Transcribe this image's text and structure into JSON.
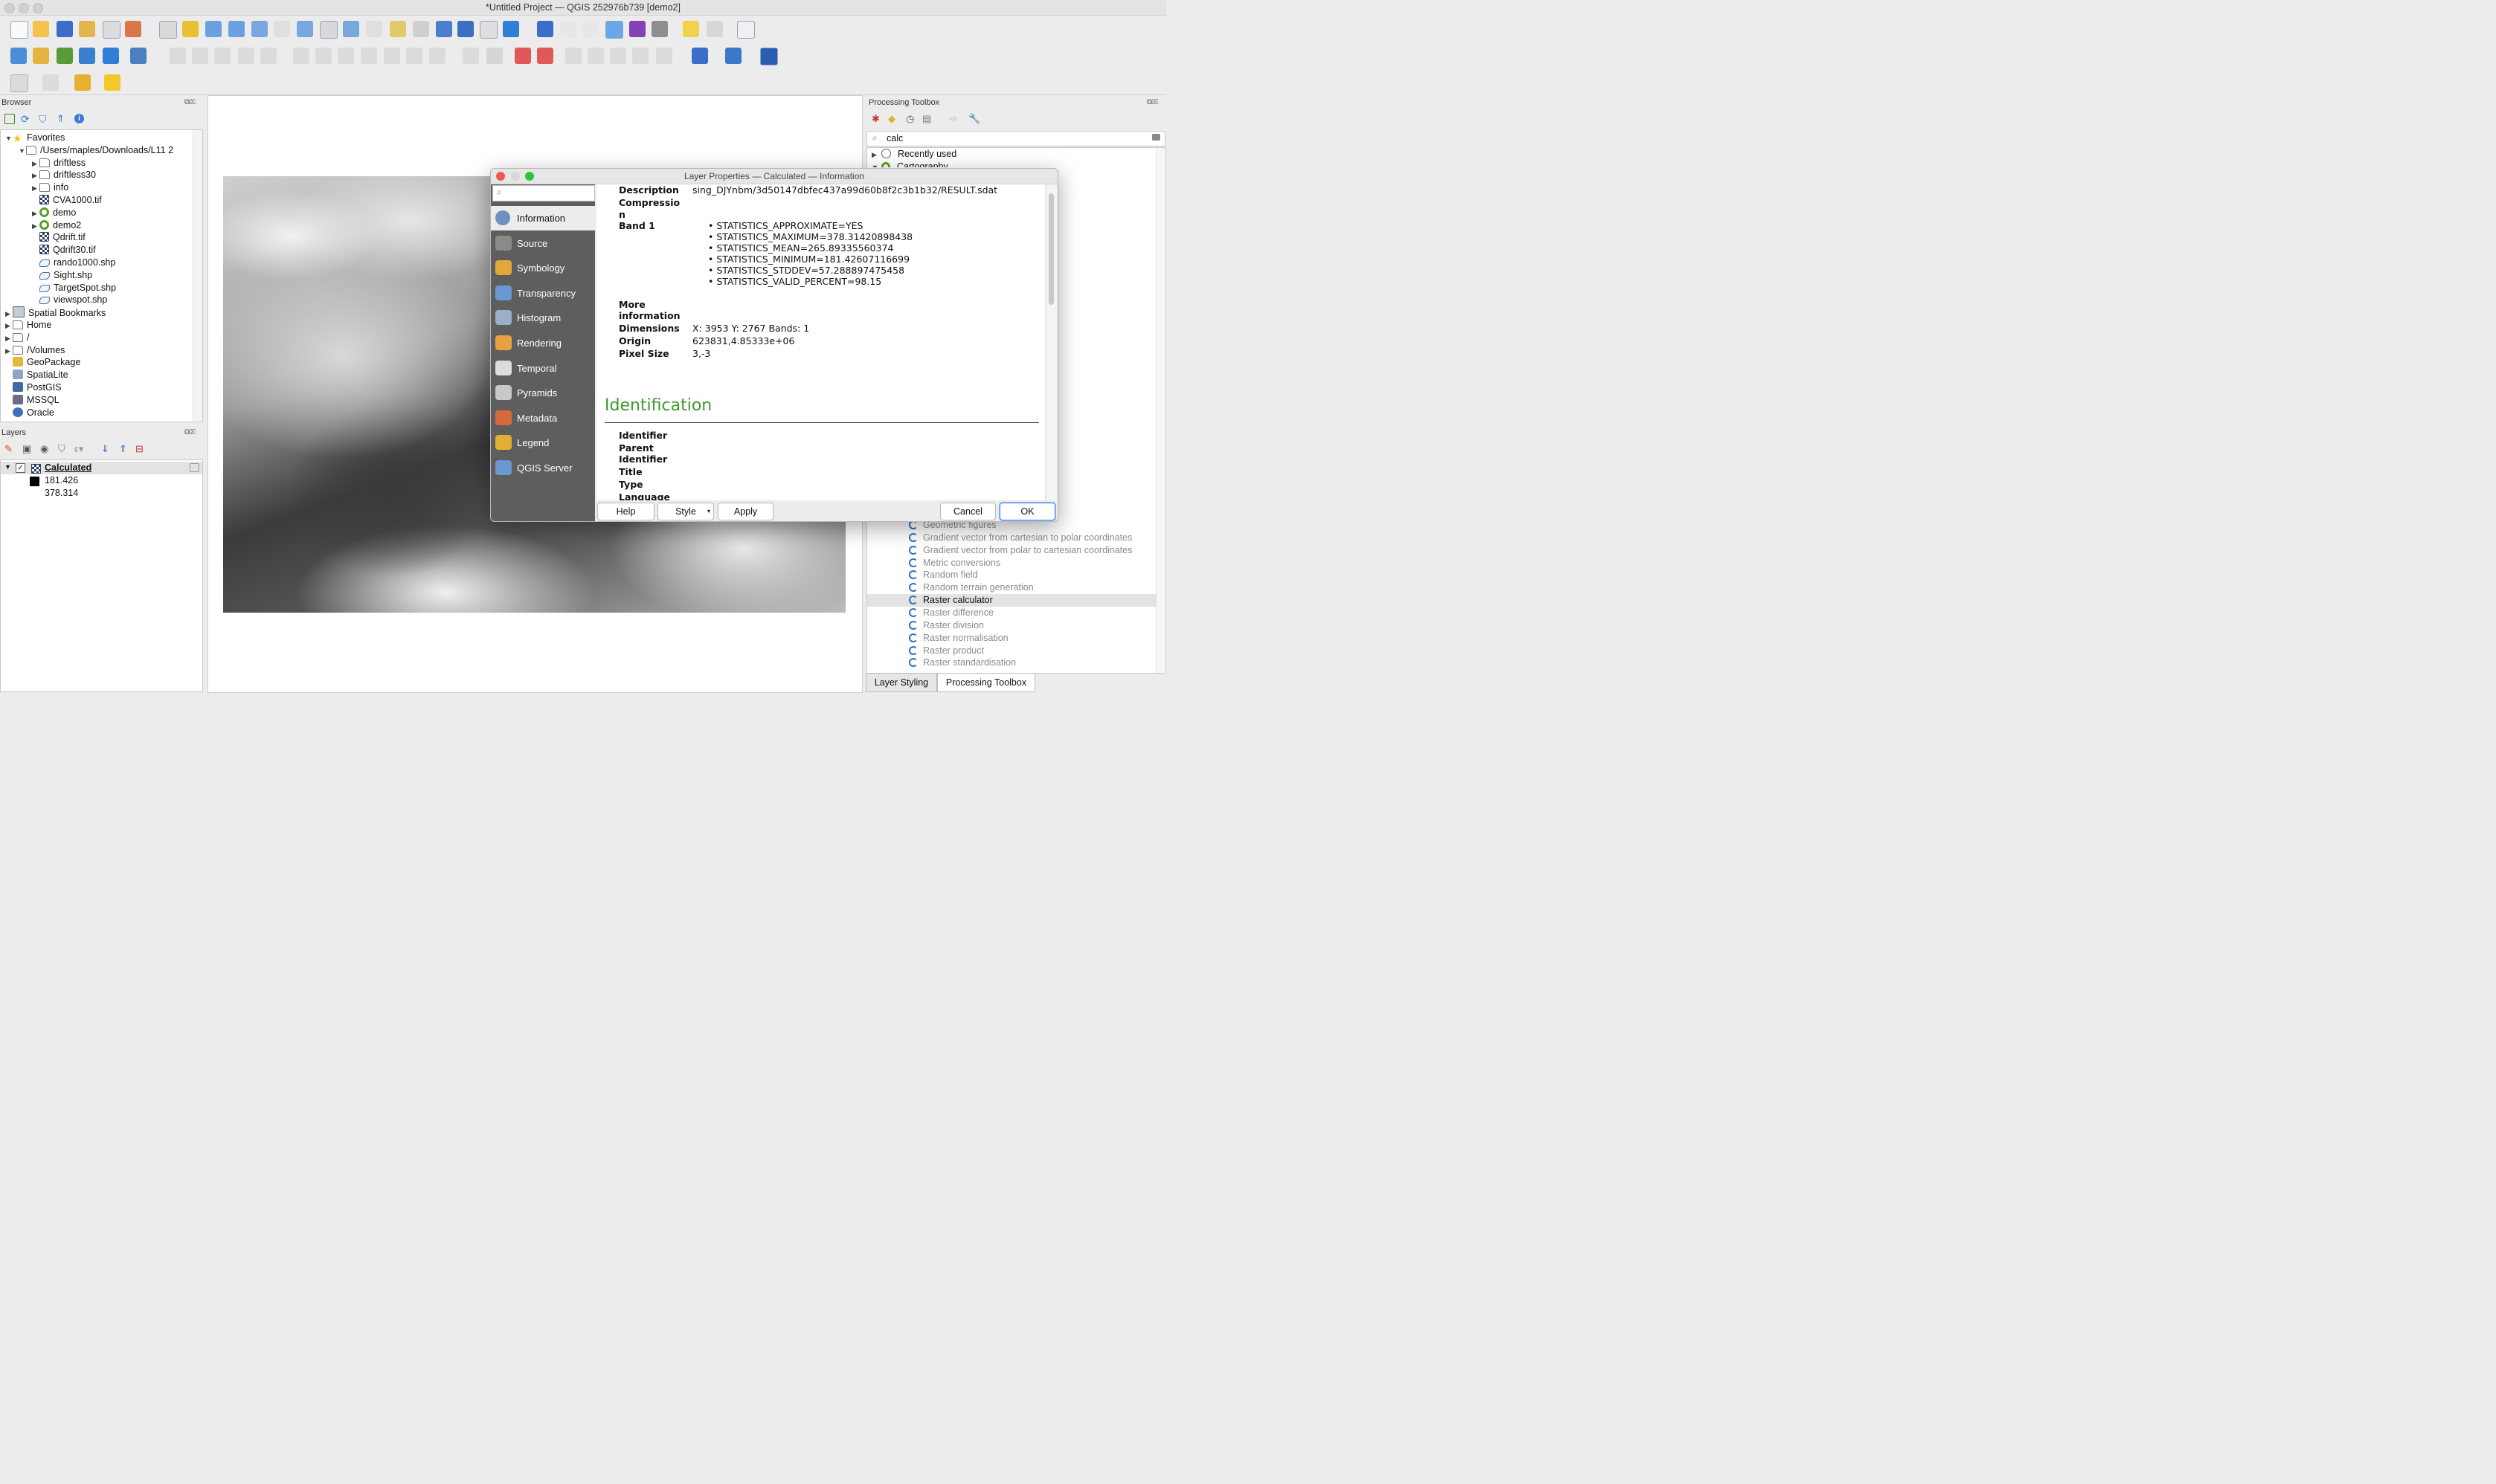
{
  "window": {
    "title": "*Untitled Project — QGIS 252976b739 [demo2]"
  },
  "browser": {
    "title": "Browser",
    "items": [
      {
        "label": "Favorites",
        "arrow": "▼",
        "icon": "star-icon"
      },
      {
        "label": "/Users/maples/Downloads/L11 2",
        "arrow": "▼",
        "icon": "folder-icon"
      },
      {
        "label": "driftless",
        "arrow": "▶",
        "icon": "folder-icon"
      },
      {
        "label": "driftless30",
        "arrow": "▶",
        "icon": "folder-icon"
      },
      {
        "label": "info",
        "arrow": "▶",
        "icon": "folder-icon"
      },
      {
        "label": "CVA1000.tif",
        "arrow": "",
        "icon": "raster-icon"
      },
      {
        "label": "demo",
        "arrow": "▶",
        "icon": "qgis-project-icon"
      },
      {
        "label": "demo2",
        "arrow": "▶",
        "icon": "qgis-project-icon"
      },
      {
        "label": "Qdrift.tif",
        "arrow": "",
        "icon": "raster-icon"
      },
      {
        "label": "Qdrift30.tif",
        "arrow": "",
        "icon": "raster-icon"
      },
      {
        "label": "rando1000.shp",
        "arrow": "",
        "icon": "vector-icon"
      },
      {
        "label": "Sight.shp",
        "arrow": "",
        "icon": "vector-icon"
      },
      {
        "label": "TargetSpot.shp",
        "arrow": "",
        "icon": "vector-icon"
      },
      {
        "label": "viewspot.shp",
        "arrow": "",
        "icon": "vector-icon"
      },
      {
        "label": "Spatial Bookmarks",
        "arrow": "▶",
        "icon": "bookmark-icon"
      },
      {
        "label": "Home",
        "arrow": "▶",
        "icon": "folder-icon"
      },
      {
        "label": "/",
        "arrow": "▶",
        "icon": "folder-icon"
      },
      {
        "label": "/Volumes",
        "arrow": "▶",
        "icon": "folder-icon"
      },
      {
        "label": "GeoPackage",
        "arrow": "",
        "icon": "geopackage-icon"
      },
      {
        "label": "SpatiaLite",
        "arrow": "",
        "icon": "spatialite-icon"
      },
      {
        "label": "PostGIS",
        "arrow": "",
        "icon": "postgis-icon"
      },
      {
        "label": "MSSQL",
        "arrow": "",
        "icon": "mssql-icon"
      },
      {
        "label": "Oracle",
        "arrow": "",
        "icon": "oracle-icon"
      }
    ]
  },
  "layers": {
    "title": "Layers",
    "layer_name": "Calculated",
    "min": "181.426",
    "max": "378.314"
  },
  "toolbox": {
    "title": "Processing Toolbox",
    "search_value": "calc",
    "groups": [
      {
        "label": "Recently used"
      },
      {
        "label": "Cartography"
      }
    ],
    "algorithms": [
      {
        "label": "Geometric figures",
        "selected": false
      },
      {
        "label": "Gradient vector from cartesian to polar coordinates",
        "selected": false
      },
      {
        "label": "Gradient vector from polar to cartesian coordinates",
        "selected": false
      },
      {
        "label": "Metric conversions",
        "selected": false
      },
      {
        "label": "Random field",
        "selected": false
      },
      {
        "label": "Random terrain generation",
        "selected": false
      },
      {
        "label": "Raster calculator",
        "selected": true
      },
      {
        "label": "Raster difference",
        "selected": false
      },
      {
        "label": "Raster division",
        "selected": false
      },
      {
        "label": "Raster normalisation",
        "selected": false
      },
      {
        "label": "Raster product",
        "selected": false
      },
      {
        "label": "Raster standardisation",
        "selected": false
      }
    ]
  },
  "bottom_tabs": [
    {
      "label": "Layer Styling"
    },
    {
      "label": "Processing Toolbox"
    }
  ],
  "dialog": {
    "title": "Layer Properties — Calculated — Information",
    "search_placeholder": "",
    "sidebar": [
      {
        "label": "Information",
        "icon": "information-icon"
      },
      {
        "label": "Source",
        "icon": "source-icon"
      },
      {
        "label": "Symbology",
        "icon": "symbology-icon"
      },
      {
        "label": "Transparency",
        "icon": "transparency-icon"
      },
      {
        "label": "Histogram",
        "icon": "histogram-icon"
      },
      {
        "label": "Rendering",
        "icon": "rendering-icon"
      },
      {
        "label": "Temporal",
        "icon": "temporal-icon"
      },
      {
        "label": "Pyramids",
        "icon": "pyramids-icon"
      },
      {
        "label": "Metadata",
        "icon": "metadata-icon"
      },
      {
        "label": "Legend",
        "icon": "legend-icon"
      },
      {
        "label": "QGIS Server",
        "icon": "qgis-server-icon"
      }
    ],
    "info": {
      "description_label": "Description",
      "description_value": "sing_DJYnbm/3d50147dbfec437a99d60b8f2c3b1b32/RESULT.sdat",
      "compression_label": "Compressio",
      "compression_label_wrap": "n",
      "band_label": "Band 1",
      "band_stats": [
        "STATISTICS_APPROXIMATE=YES",
        "STATISTICS_MAXIMUM=378.31420898438",
        "STATISTICS_MEAN=265.89335560374",
        "STATISTICS_MINIMUM=181.42607116699",
        "STATISTICS_STDDEV=57.288897475458",
        "STATISTICS_VALID_PERCENT=98.15"
      ],
      "more_label": "More",
      "more_label_wrap": "information",
      "dimensions_label": "Dimensions",
      "dimensions_value": "X: 3953 Y: 2767 Bands: 1",
      "origin_label": "Origin",
      "origin_value": "623831,4.85333e+06",
      "pixel_label": "Pixel Size",
      "pixel_value": "3,-3",
      "identification_heading": "Identification",
      "id_fields": [
        "Identifier",
        "Parent",
        "Identifier",
        "Title",
        "Type",
        "Language"
      ]
    },
    "buttons": {
      "help": "Help",
      "style": "Style",
      "apply": "Apply",
      "cancel": "Cancel",
      "ok": "OK"
    }
  },
  "colors": {
    "accent_green": "#3c9a2e",
    "selection_gray": "#e3e3e3",
    "dialog_sidebar": "#5e5e5e"
  }
}
